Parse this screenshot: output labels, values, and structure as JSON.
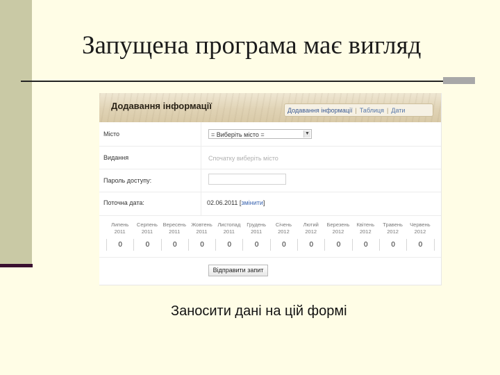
{
  "slide": {
    "title": "Запущена програма має вигляд",
    "caption": "Заносити дані на цій формі"
  },
  "form": {
    "header_title": "Додавання інформації",
    "tabs": [
      {
        "label": "Додавання інформації",
        "active": true
      },
      {
        "label": "Таблиця",
        "active": false
      },
      {
        "label": "Дати",
        "active": false
      }
    ],
    "fields": {
      "city_label": "Місто",
      "city_value": "= Виберіть місто =",
      "edition_label": "Видання",
      "edition_hint": "Спочатку виберіть місто",
      "password_label": "Пароль доступу:",
      "password_value": "",
      "date_label": "Поточна дата:",
      "date_value": "02.06.2011",
      "date_change_link": "змінити",
      "date_open_bracket": "[",
      "date_close_bracket": "]"
    },
    "months": [
      {
        "name": "Липень",
        "year": "2011"
      },
      {
        "name": "Серпень",
        "year": "2011"
      },
      {
        "name": "Вересень",
        "year": "2011"
      },
      {
        "name": "Жовтень",
        "year": "2011"
      },
      {
        "name": "Листопад",
        "year": "2011"
      },
      {
        "name": "Грудень",
        "year": "2011"
      },
      {
        "name": "Січень",
        "year": "2012"
      },
      {
        "name": "Лютий",
        "year": "2012"
      },
      {
        "name": "Березень",
        "year": "2012"
      },
      {
        "name": "Квітень",
        "year": "2012"
      },
      {
        "name": "Травень",
        "year": "2012"
      },
      {
        "name": "Червень",
        "year": "2012"
      }
    ],
    "counts": [
      "0",
      "0",
      "0",
      "0",
      "0",
      "0",
      "0",
      "0",
      "0",
      "0",
      "0",
      "0"
    ],
    "save_button": "Відправити запит"
  }
}
